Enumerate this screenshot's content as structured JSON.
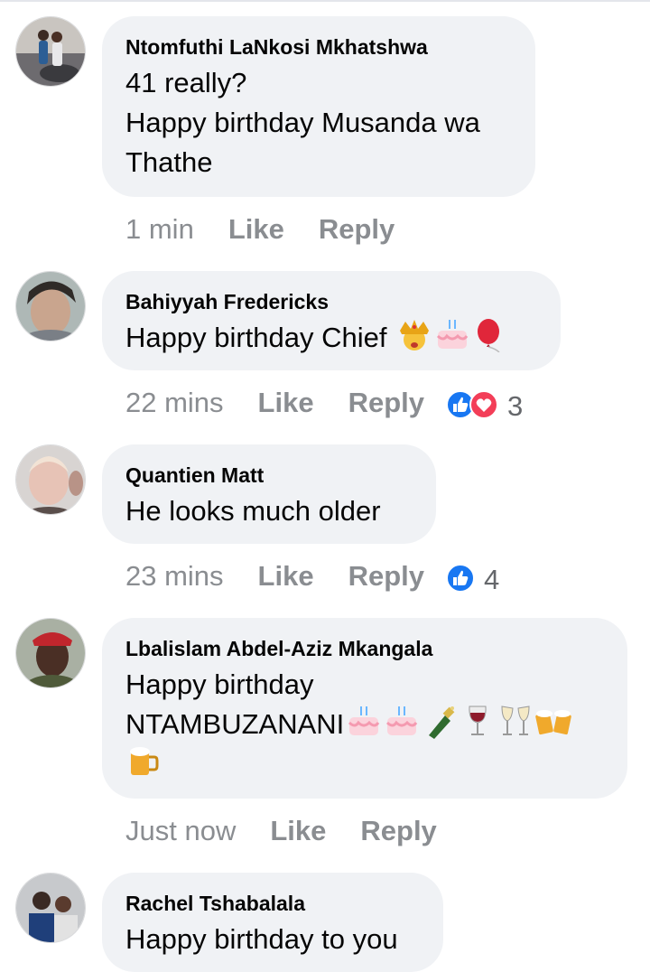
{
  "comments": [
    {
      "author": "Ntomfuthi LaNkosi Mkhatshwa",
      "text_lines": [
        "41 really?",
        "Happy birthday Musanda wa",
        "Thathe"
      ],
      "time": "1 min",
      "like_label": "Like",
      "reply_label": "Reply",
      "reactions": null
    },
    {
      "author": "Bahiyyah Fredericks",
      "text": "Happy birthday Chief",
      "emojis": [
        "crown-face-emoji",
        "birthday-cake-emoji",
        "red-balloon-emoji"
      ],
      "time": "22 mins",
      "like_label": "Like",
      "reply_label": "Reply",
      "reactions": {
        "icons": [
          "like-reaction-icon",
          "love-reaction-icon"
        ],
        "count": "3"
      }
    },
    {
      "author": "Quantien Matt",
      "text": "He looks much older",
      "time": "23 mins",
      "like_label": "Like",
      "reply_label": "Reply",
      "reactions": {
        "icons": [
          "like-reaction-icon"
        ],
        "count": "4"
      }
    },
    {
      "author": "Lbalislam Abdel-Aziz Mkangala",
      "text_line1": "Happy birthday",
      "text_line2": "NTAMBUZANANI",
      "emojis": [
        "birthday-cake-emoji",
        "birthday-cake-emoji",
        "champagne-emoji",
        "wine-glass-emoji",
        "clinking-glasses-emoji",
        "clinking-beer-mugs-emoji",
        "beer-mug-emoji"
      ],
      "time": "Just now",
      "like_label": "Like",
      "reply_label": "Reply",
      "reactions": null
    },
    {
      "author": "Rachel Tshabalala",
      "text": "Happy birthday to you"
    }
  ],
  "colors": {
    "bubble": "#f0f2f5",
    "meta_text": "#8a8d91",
    "like_blue": "#1877f2",
    "love_red": "#f33e58"
  }
}
